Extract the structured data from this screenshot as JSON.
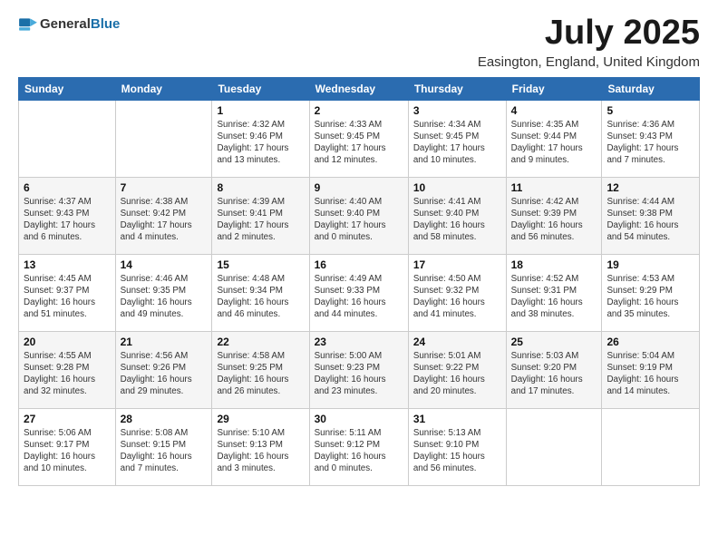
{
  "header": {
    "logo_general": "General",
    "logo_blue": "Blue",
    "title": "July 2025",
    "subtitle": "Easington, England, United Kingdom"
  },
  "days_of_week": [
    "Sunday",
    "Monday",
    "Tuesday",
    "Wednesday",
    "Thursday",
    "Friday",
    "Saturday"
  ],
  "weeks": [
    [
      {
        "num": "",
        "detail": ""
      },
      {
        "num": "",
        "detail": ""
      },
      {
        "num": "1",
        "detail": "Sunrise: 4:32 AM\nSunset: 9:46 PM\nDaylight: 17 hours\nand 13 minutes."
      },
      {
        "num": "2",
        "detail": "Sunrise: 4:33 AM\nSunset: 9:45 PM\nDaylight: 17 hours\nand 12 minutes."
      },
      {
        "num": "3",
        "detail": "Sunrise: 4:34 AM\nSunset: 9:45 PM\nDaylight: 17 hours\nand 10 minutes."
      },
      {
        "num": "4",
        "detail": "Sunrise: 4:35 AM\nSunset: 9:44 PM\nDaylight: 17 hours\nand 9 minutes."
      },
      {
        "num": "5",
        "detail": "Sunrise: 4:36 AM\nSunset: 9:43 PM\nDaylight: 17 hours\nand 7 minutes."
      }
    ],
    [
      {
        "num": "6",
        "detail": "Sunrise: 4:37 AM\nSunset: 9:43 PM\nDaylight: 17 hours\nand 6 minutes."
      },
      {
        "num": "7",
        "detail": "Sunrise: 4:38 AM\nSunset: 9:42 PM\nDaylight: 17 hours\nand 4 minutes."
      },
      {
        "num": "8",
        "detail": "Sunrise: 4:39 AM\nSunset: 9:41 PM\nDaylight: 17 hours\nand 2 minutes."
      },
      {
        "num": "9",
        "detail": "Sunrise: 4:40 AM\nSunset: 9:40 PM\nDaylight: 17 hours\nand 0 minutes."
      },
      {
        "num": "10",
        "detail": "Sunrise: 4:41 AM\nSunset: 9:40 PM\nDaylight: 16 hours\nand 58 minutes."
      },
      {
        "num": "11",
        "detail": "Sunrise: 4:42 AM\nSunset: 9:39 PM\nDaylight: 16 hours\nand 56 minutes."
      },
      {
        "num": "12",
        "detail": "Sunrise: 4:44 AM\nSunset: 9:38 PM\nDaylight: 16 hours\nand 54 minutes."
      }
    ],
    [
      {
        "num": "13",
        "detail": "Sunrise: 4:45 AM\nSunset: 9:37 PM\nDaylight: 16 hours\nand 51 minutes."
      },
      {
        "num": "14",
        "detail": "Sunrise: 4:46 AM\nSunset: 9:35 PM\nDaylight: 16 hours\nand 49 minutes."
      },
      {
        "num": "15",
        "detail": "Sunrise: 4:48 AM\nSunset: 9:34 PM\nDaylight: 16 hours\nand 46 minutes."
      },
      {
        "num": "16",
        "detail": "Sunrise: 4:49 AM\nSunset: 9:33 PM\nDaylight: 16 hours\nand 44 minutes."
      },
      {
        "num": "17",
        "detail": "Sunrise: 4:50 AM\nSunset: 9:32 PM\nDaylight: 16 hours\nand 41 minutes."
      },
      {
        "num": "18",
        "detail": "Sunrise: 4:52 AM\nSunset: 9:31 PM\nDaylight: 16 hours\nand 38 minutes."
      },
      {
        "num": "19",
        "detail": "Sunrise: 4:53 AM\nSunset: 9:29 PM\nDaylight: 16 hours\nand 35 minutes."
      }
    ],
    [
      {
        "num": "20",
        "detail": "Sunrise: 4:55 AM\nSunset: 9:28 PM\nDaylight: 16 hours\nand 32 minutes."
      },
      {
        "num": "21",
        "detail": "Sunrise: 4:56 AM\nSunset: 9:26 PM\nDaylight: 16 hours\nand 29 minutes."
      },
      {
        "num": "22",
        "detail": "Sunrise: 4:58 AM\nSunset: 9:25 PM\nDaylight: 16 hours\nand 26 minutes."
      },
      {
        "num": "23",
        "detail": "Sunrise: 5:00 AM\nSunset: 9:23 PM\nDaylight: 16 hours\nand 23 minutes."
      },
      {
        "num": "24",
        "detail": "Sunrise: 5:01 AM\nSunset: 9:22 PM\nDaylight: 16 hours\nand 20 minutes."
      },
      {
        "num": "25",
        "detail": "Sunrise: 5:03 AM\nSunset: 9:20 PM\nDaylight: 16 hours\nand 17 minutes."
      },
      {
        "num": "26",
        "detail": "Sunrise: 5:04 AM\nSunset: 9:19 PM\nDaylight: 16 hours\nand 14 minutes."
      }
    ],
    [
      {
        "num": "27",
        "detail": "Sunrise: 5:06 AM\nSunset: 9:17 PM\nDaylight: 16 hours\nand 10 minutes."
      },
      {
        "num": "28",
        "detail": "Sunrise: 5:08 AM\nSunset: 9:15 PM\nDaylight: 16 hours\nand 7 minutes."
      },
      {
        "num": "29",
        "detail": "Sunrise: 5:10 AM\nSunset: 9:13 PM\nDaylight: 16 hours\nand 3 minutes."
      },
      {
        "num": "30",
        "detail": "Sunrise: 5:11 AM\nSunset: 9:12 PM\nDaylight: 16 hours\nand 0 minutes."
      },
      {
        "num": "31",
        "detail": "Sunrise: 5:13 AM\nSunset: 9:10 PM\nDaylight: 15 hours\nand 56 minutes."
      },
      {
        "num": "",
        "detail": ""
      },
      {
        "num": "",
        "detail": ""
      }
    ]
  ]
}
